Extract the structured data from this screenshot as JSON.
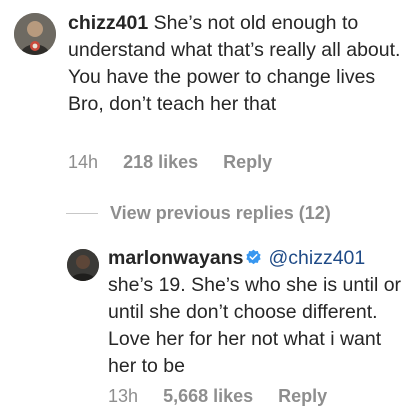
{
  "comment": {
    "username": "chizz401",
    "text": "She’s not old enough to understand what that’s really all about. You have the power to change lives Bro, don’t teach her that",
    "time": "14h",
    "likes": "218 likes",
    "reply_label": "Reply"
  },
  "view_replies": {
    "label": "View previous replies (12)"
  },
  "reply": {
    "username": "marlonwayans",
    "mention": "@chizz401",
    "text": "she’s 19. She’s who she is until or until she don’t choose different. Love her for her not what i want her to be",
    "time": "13h",
    "likes": "5,668 likes",
    "reply_label": "Reply"
  },
  "colors": {
    "text": "#262626",
    "meta": "#8e8e8e",
    "mention": "#1f4b87",
    "verified": "#3897f0"
  },
  "icons": {
    "verified": "verified-badge-icon"
  }
}
